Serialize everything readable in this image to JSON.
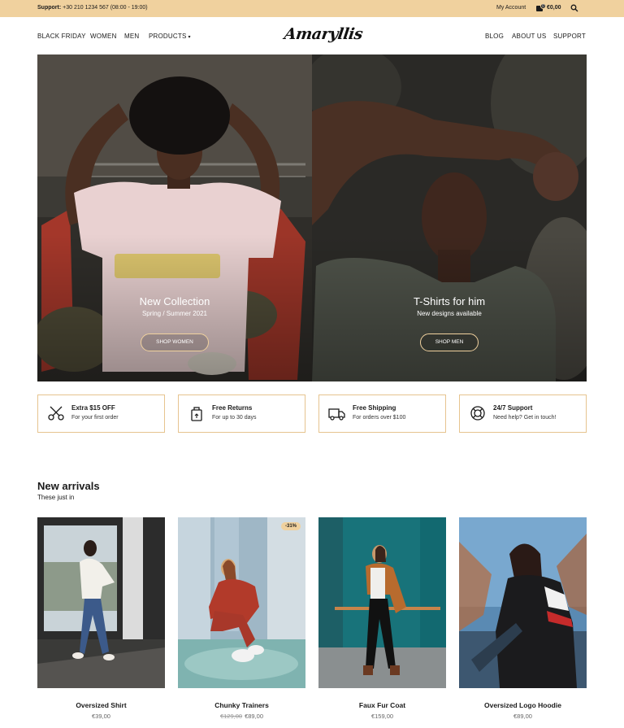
{
  "topbar": {
    "support_label": "Support:",
    "support_phone": "+30 210 1234 567 (08:00 - 19:00)",
    "account": "My Account",
    "cart_count": "0",
    "cart_total": "€0,00"
  },
  "nav": {
    "left": [
      "BLACK FRIDAY",
      "WOMEN",
      "MEN",
      "PRODUCTS"
    ],
    "right": [
      "BLOG",
      "ABOUT US",
      "SUPPORT"
    ],
    "logo": "Amaryllis"
  },
  "hero": [
    {
      "title": "New Collection",
      "subtitle": "Spring / Summer 2021",
      "button": "SHOP WOMEN"
    },
    {
      "title": "T-Shirts for him",
      "subtitle": "New designs available",
      "button": "SHOP MEN"
    }
  ],
  "features": [
    {
      "title": "Extra $15 OFF",
      "subtitle": "For your first order",
      "icon": "scissors-icon"
    },
    {
      "title": "Free Returns",
      "subtitle": "For up to 30 days",
      "icon": "return-bag-icon"
    },
    {
      "title": "Free Shipping",
      "subtitle": "For orders over $100",
      "icon": "truck-icon"
    },
    {
      "title": "24/7 Support",
      "subtitle": "Need help? Get in touch!",
      "icon": "lifebuoy-icon"
    }
  ],
  "arrivals": {
    "title": "New arrivals",
    "subtitle": "These just in",
    "products": [
      {
        "name": "Oversized Shirt",
        "price": "€39,00",
        "old_price": "",
        "badge": ""
      },
      {
        "name": "Chunky Trainers",
        "price": "€89,00",
        "old_price": "€129,00",
        "badge": "-31%"
      },
      {
        "name": "Faux Fur Coat",
        "price": "€159,00",
        "old_price": "",
        "badge": ""
      },
      {
        "name": "Oversized Logo Hoodie",
        "price": "€89,00",
        "old_price": "",
        "badge": ""
      }
    ]
  },
  "colors": {
    "accent": "#f0d19e",
    "accent_border": "#e6c48f",
    "text": "#1b1b1b"
  }
}
